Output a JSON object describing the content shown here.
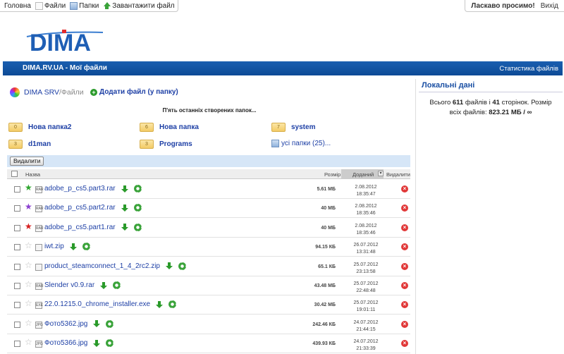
{
  "topbar": {
    "home": "Головна",
    "files": "Файли",
    "folders": "Папки",
    "upload": "Завантажити файл",
    "welcome": "Ласкаво просимо!",
    "logout": "Вихід"
  },
  "logo": {
    "text": "DIMA"
  },
  "header": {
    "title": "DIMA.RV.UA - Мої файли",
    "stats": "Статистика файлів"
  },
  "breadcrumb": {
    "root": "DIMA SRV",
    "sep_current": "/Файли"
  },
  "add_file": "Додати файл (у папку)",
  "last_folders_title": "П'ять останніх створених папок...",
  "folders": [
    {
      "count": "0",
      "name": "Нова папка2"
    },
    {
      "count": "6",
      "name": "Нова папка"
    },
    {
      "count": "7",
      "name": "system"
    },
    {
      "count": "3",
      "name": "d1man"
    },
    {
      "count": "3",
      "name": "Programs"
    }
  ],
  "all_folders": "усі папки (25)...",
  "delete_button": "Видалити",
  "columns": {
    "name": "Назва",
    "size": "Розмір",
    "added": "Доданий",
    "delete": "Видалити"
  },
  "files": [
    {
      "name": "adobe_p_cs5.part3.rar",
      "ext": "RAR",
      "size": "5.61 МБ",
      "date": "2.08.2012",
      "time": "18:35:47",
      "star": "green"
    },
    {
      "name": "adobe_p_cs5.part2.rar",
      "ext": "RAR",
      "size": "40 МБ",
      "date": "2.08.2012",
      "time": "18:35:46",
      "star": "purple"
    },
    {
      "name": "adobe_p_cs5.part1.rar",
      "ext": "RAR",
      "size": "40 МБ",
      "date": "2.08.2012",
      "time": "18:35:46",
      "star": "red"
    },
    {
      "name": "iwt.zip",
      "ext": "",
      "size": "94.15 КБ",
      "date": "26.07.2012",
      "time": "13:31:48",
      "star": "none"
    },
    {
      "name": "product_steamconnect_1_4_2rc2.zip",
      "ext": "",
      "size": "65.1 КБ",
      "date": "25.07.2012",
      "time": "23:13:58",
      "star": "none"
    },
    {
      "name": "Slender v0.9.rar",
      "ext": "RAR",
      "size": "43.48 МБ",
      "date": "25.07.2012",
      "time": "22:48:48",
      "star": "none"
    },
    {
      "name": "22.0.1215.0_chrome_installer.exe",
      "ext": "EXE",
      "size": "30.42 МБ",
      "date": "25.07.2012",
      "time": "19:01:11",
      "star": "none"
    },
    {
      "name": "Фото5362.jpg",
      "ext": "JPG",
      "size": "242.46 КБ",
      "date": "24.07.2012",
      "time": "21:44:15",
      "star": "none"
    },
    {
      "name": "Фото5366.jpg",
      "ext": "JPG",
      "size": "439.93 КБ",
      "date": "24.07.2012",
      "time": "21:33:39",
      "star": "none"
    }
  ],
  "sidebar": {
    "title": "Локальні дані",
    "stats_prefix": "Всього ",
    "files_count": "611",
    "mid1": " файлів і ",
    "pages_count": "41",
    "mid2": " сторінок. Розмір всіх файлів: ",
    "total_size": "823.21 МБ / ∞"
  },
  "colors": {
    "accent": "#0d4a96",
    "link": "#1d3fa5",
    "download": "#2a9a2a",
    "delete": "#e13838"
  }
}
